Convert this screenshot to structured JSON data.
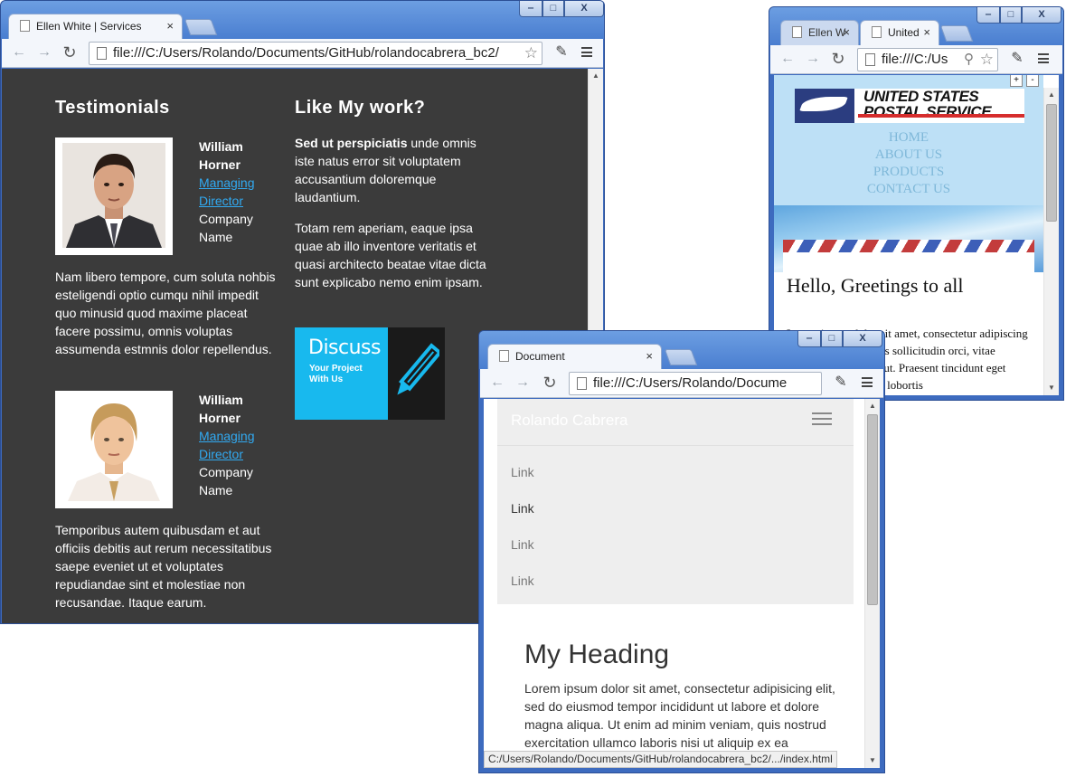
{
  "window_ellen": {
    "tab_title": "Ellen White | Services",
    "tab_close": "×",
    "url": "file:///C:/Users/Rolando/Documents/GitHub/rolandocabrera_bc2/",
    "testimonials_heading": "Testimonials",
    "testimonials": [
      {
        "name": "William Horner",
        "role": "Managing Director",
        "company": "Company Name",
        "quote": "Nam libero tempore, cum soluta nohbis esteligendi optio cumqu nihil impedit quo minusid quod maxime placeat facere possimu, omnis voluptas assumenda estmnis dolor repellendus."
      },
      {
        "name": "William Horner",
        "role": "Managing Director",
        "company": "Company Name",
        "quote": "Temporibus autem quibusdam et aut officiis debitis aut rerum necessitatibus saepe eveniet ut et voluptates repudiandae sint et molestiae non recusandae. Itaque earum."
      }
    ],
    "like_heading": "Like My work?",
    "like_p1_bold": "Sed ut perspiciatis",
    "like_p1_rest": " unde omnis iste natus error sit voluptatem accusantium doloremque laudantium.",
    "like_p2": "Totam rem aperiam, eaque ipsa quae ab illo inventore veritatis et quasi architecto beatae vitae dicta sunt explicabo nemo enim ipsam.",
    "discuss_title": "Discuss",
    "discuss_sub_1": "Your Project",
    "discuss_sub_2": "With Us"
  },
  "window_usps": {
    "tab1_title": "Ellen W",
    "tab2_title": "United",
    "tab_close": "×",
    "url": "file:///C:/Us",
    "zoom_plus": "+",
    "zoom_minus": "-",
    "logo_line1": "UNITED STATES",
    "logo_line2": "POSTAL SERVICE",
    "nav": [
      "HOME",
      "ABOUT US",
      "PRODUCTS",
      "CONTACT US"
    ],
    "greeting": "Hello, Greetings to all",
    "body": "Lorem ipsum dolor sit amet, consectetur adipiscing elit. Phasellus sodales sollicitudin orci, vitae efficitur consectetur ut. Praesent tincidunt eget tortor lorem. Aenean lobortis"
  },
  "window_doc": {
    "tab_title": "Document",
    "tab_close": "×",
    "url": "file:///C:/Users/Rolando/Docume",
    "brand": "Rolando Cabrera",
    "links": [
      "Link",
      "Link",
      "Link",
      "Link"
    ],
    "heading": "My Heading",
    "paragraph": "Lorem ipsum dolor sit amet, consectetur adipisicing elit, sed do eiusmod tempor incididunt ut labore et dolore magna aliqua. Ut enim ad minim veniam, quis nostrud exercitation ullamco laboris nisi ut aliquip ex ea commodo",
    "status_url": "C:/Users/Rolando/Documents/GitHub/rolandocabrera_bc2/.../index.html"
  },
  "window_controls": {
    "minimize": "‒",
    "maximize": "□",
    "close": "X"
  },
  "colors": {
    "link": "#31aaf2",
    "dark_bg": "#3b3b3b",
    "usps_header": "#bde0f6",
    "discuss_blue": "#18b9ee",
    "chrome_frame": "#4a7ed0"
  }
}
